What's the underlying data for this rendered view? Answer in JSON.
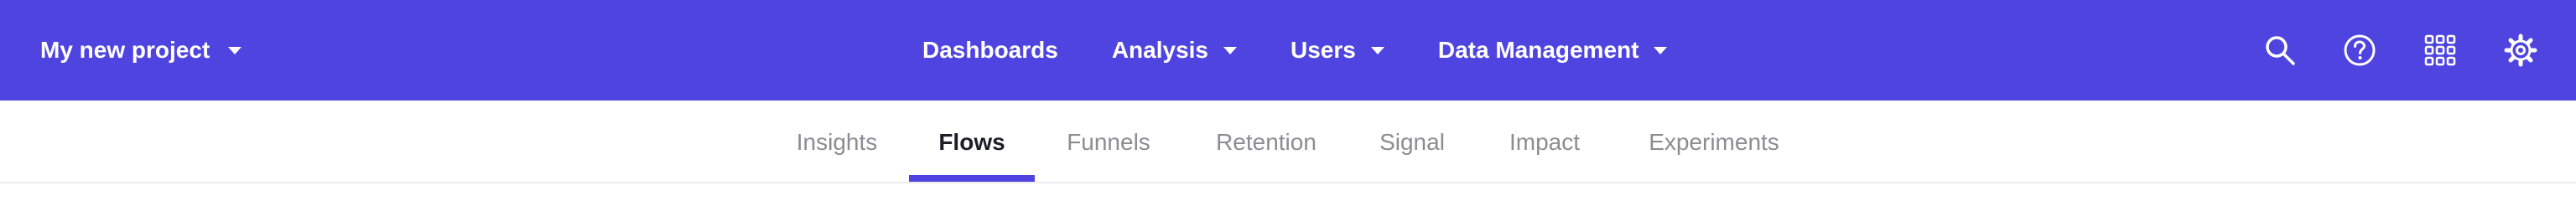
{
  "header": {
    "project_name": "My new project",
    "nav": [
      {
        "label": "Dashboards",
        "has_dropdown": false
      },
      {
        "label": "Analysis",
        "has_dropdown": true
      },
      {
        "label": "Users",
        "has_dropdown": true
      },
      {
        "label": "Data Management",
        "has_dropdown": true
      }
    ],
    "tools": [
      "search-icon",
      "help-icon",
      "apps-grid-icon",
      "settings-icon"
    ]
  },
  "subnav": {
    "tabs": [
      {
        "label": "Insights",
        "active": false
      },
      {
        "label": "Flows",
        "active": true
      },
      {
        "label": "Funnels",
        "active": false
      },
      {
        "label": "Retention",
        "active": false
      },
      {
        "label": "Signal",
        "active": false
      },
      {
        "label": "Impact",
        "active": false
      },
      {
        "label": "Experiments",
        "active": false
      }
    ]
  },
  "colors": {
    "brand": "#4f44e0",
    "active_text": "#1e1e26",
    "inactive_text": "#8c8c92"
  }
}
